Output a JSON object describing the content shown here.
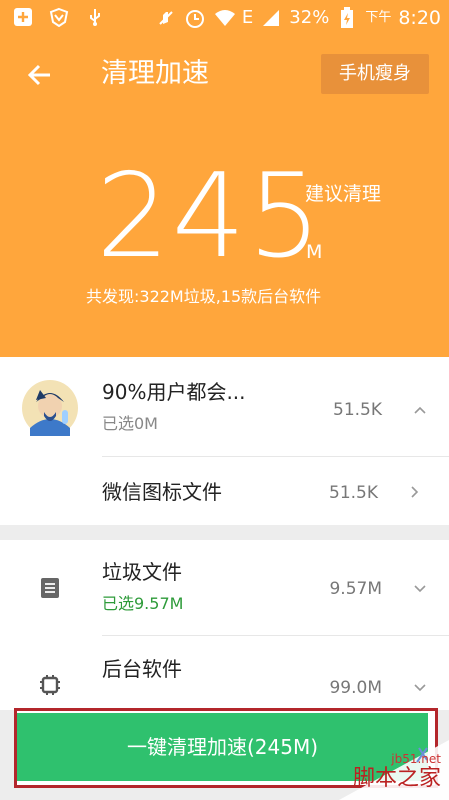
{
  "status_bar": {
    "battery_percent": "32%",
    "network": "E",
    "time_prefix": "下午",
    "time": "8:20"
  },
  "header": {
    "title": "清理加速",
    "slim_button": "手机瘦身",
    "cleanable_amount": "245",
    "suggest_label": "建议清理",
    "unit": "M",
    "summary": "共发现:322M垃圾,15款后台软件"
  },
  "list": {
    "group1": {
      "title": "90%用户都会...",
      "subtitle": "已选0M",
      "size": "51.5K",
      "child": {
        "title": "微信图标文件",
        "size": "51.5K"
      }
    },
    "junk": {
      "title": "垃圾文件",
      "subtitle": "已选9.57M",
      "size": "9.57M"
    },
    "background": {
      "title": "后台软件",
      "size": "99.0M"
    }
  },
  "action": {
    "clean_button": "一键清理加速(245M)"
  },
  "watermark": {
    "line1": "jb51.net",
    "line2": "脚本之家"
  },
  "colors": {
    "header_bg": "#ffa63c",
    "button_green": "#2fc16e",
    "selected_green": "#2e9b3a",
    "highlight_border": "#b3262b"
  }
}
